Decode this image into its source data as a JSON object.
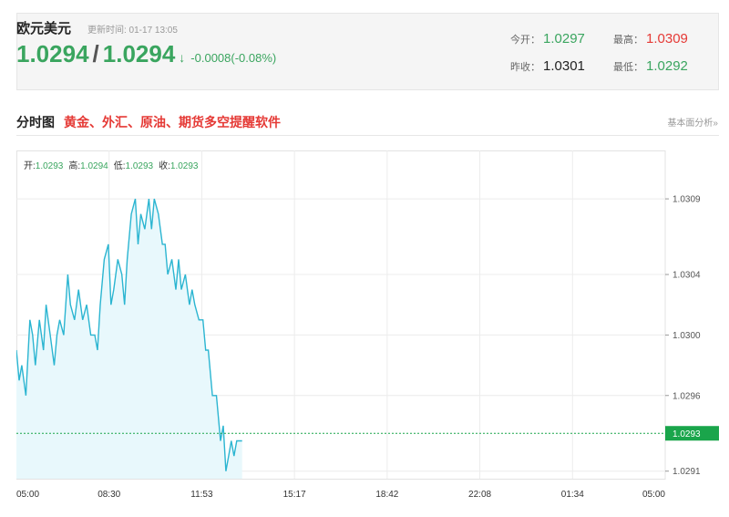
{
  "header": {
    "pair_name": "欧元美元",
    "update_label": "更新时间: 01-17 13:05",
    "bid": "1.0294",
    "slash": "/",
    "ask": "1.0294",
    "direction_arrow": "↓",
    "change": "-0.0008(-0.08%)"
  },
  "stats": {
    "open_label": "今开：",
    "open_value": "1.0297",
    "high_label": "最高：",
    "high_value": "1.0309",
    "prev_close_label": "昨收：",
    "prev_close_value": "1.0301",
    "low_label": "最低：",
    "low_value": "1.0292"
  },
  "section": {
    "title": "分时图",
    "promo": "黄金、外汇、原油、期货多空提醒软件",
    "side_link": "基本面分析»"
  },
  "ohlc": {
    "open_label": "开:",
    "open_value": "1.0293",
    "high_label": "高:",
    "high_value": "1.0294",
    "low_label": "低:",
    "low_value": "1.0293",
    "close_label": "收:",
    "close_value": "1.0293"
  },
  "colors": {
    "line": "#2bb5d1",
    "fill": "#e8f8fc",
    "up": "#3aa55f",
    "down": "#e53935",
    "current_tag": "#1aa54b"
  },
  "chart_data": {
    "type": "area",
    "x_ticks": [
      "05:00",
      "08:30",
      "11:53",
      "15:17",
      "18:42",
      "22:08",
      "01:34",
      "05:00"
    ],
    "y_ticks": [
      "1.0309",
      "1.0304",
      "1.0300",
      "1.0296",
      "1.0291"
    ],
    "current_label": "1.0293",
    "current_value": 1.02935,
    "ylim": [
      1.02905,
      1.03122
    ],
    "x_hours_range": [
      0,
      24
    ],
    "x": [
      0,
      0.1,
      0.2,
      0.35,
      0.5,
      0.6,
      0.7,
      0.85,
      1.0,
      1.1,
      1.25,
      1.4,
      1.5,
      1.6,
      1.75,
      1.9,
      2.0,
      2.15,
      2.3,
      2.45,
      2.6,
      2.75,
      2.9,
      3.0,
      3.1,
      3.25,
      3.4,
      3.5,
      3.6,
      3.75,
      3.9,
      4.0,
      4.1,
      4.25,
      4.4,
      4.5,
      4.6,
      4.75,
      4.9,
      5.0,
      5.1,
      5.25,
      5.4,
      5.5,
      5.6,
      5.75,
      5.9,
      6.0,
      6.1,
      6.25,
      6.4,
      6.5,
      6.6,
      6.75,
      6.9,
      7.0,
      7.1,
      7.25,
      7.4,
      7.55,
      7.65,
      7.75,
      7.85,
      7.95,
      8.05,
      8.15,
      8.25,
      8.35
    ],
    "y": [
      1.0299,
      1.0297,
      1.0298,
      1.0296,
      1.0301,
      1.03,
      1.0298,
      1.0301,
      1.0299,
      1.0302,
      1.03,
      1.0298,
      1.03,
      1.0301,
      1.03,
      1.0304,
      1.0302,
      1.0301,
      1.0303,
      1.0301,
      1.0302,
      1.03,
      1.03,
      1.0299,
      1.0302,
      1.0305,
      1.0306,
      1.0302,
      1.0303,
      1.0305,
      1.0304,
      1.0302,
      1.0305,
      1.0308,
      1.0309,
      1.0306,
      1.0308,
      1.0307,
      1.0309,
      1.0307,
      1.0309,
      1.0308,
      1.0306,
      1.0306,
      1.0304,
      1.0305,
      1.0303,
      1.0305,
      1.0303,
      1.0304,
      1.0302,
      1.0303,
      1.0302,
      1.0301,
      1.0301,
      1.0299,
      1.0299,
      1.0296,
      1.0296,
      1.0293,
      1.0294,
      1.0291,
      1.0292,
      1.0293,
      1.0292,
      1.0293,
      1.0293,
      1.0293
    ]
  }
}
